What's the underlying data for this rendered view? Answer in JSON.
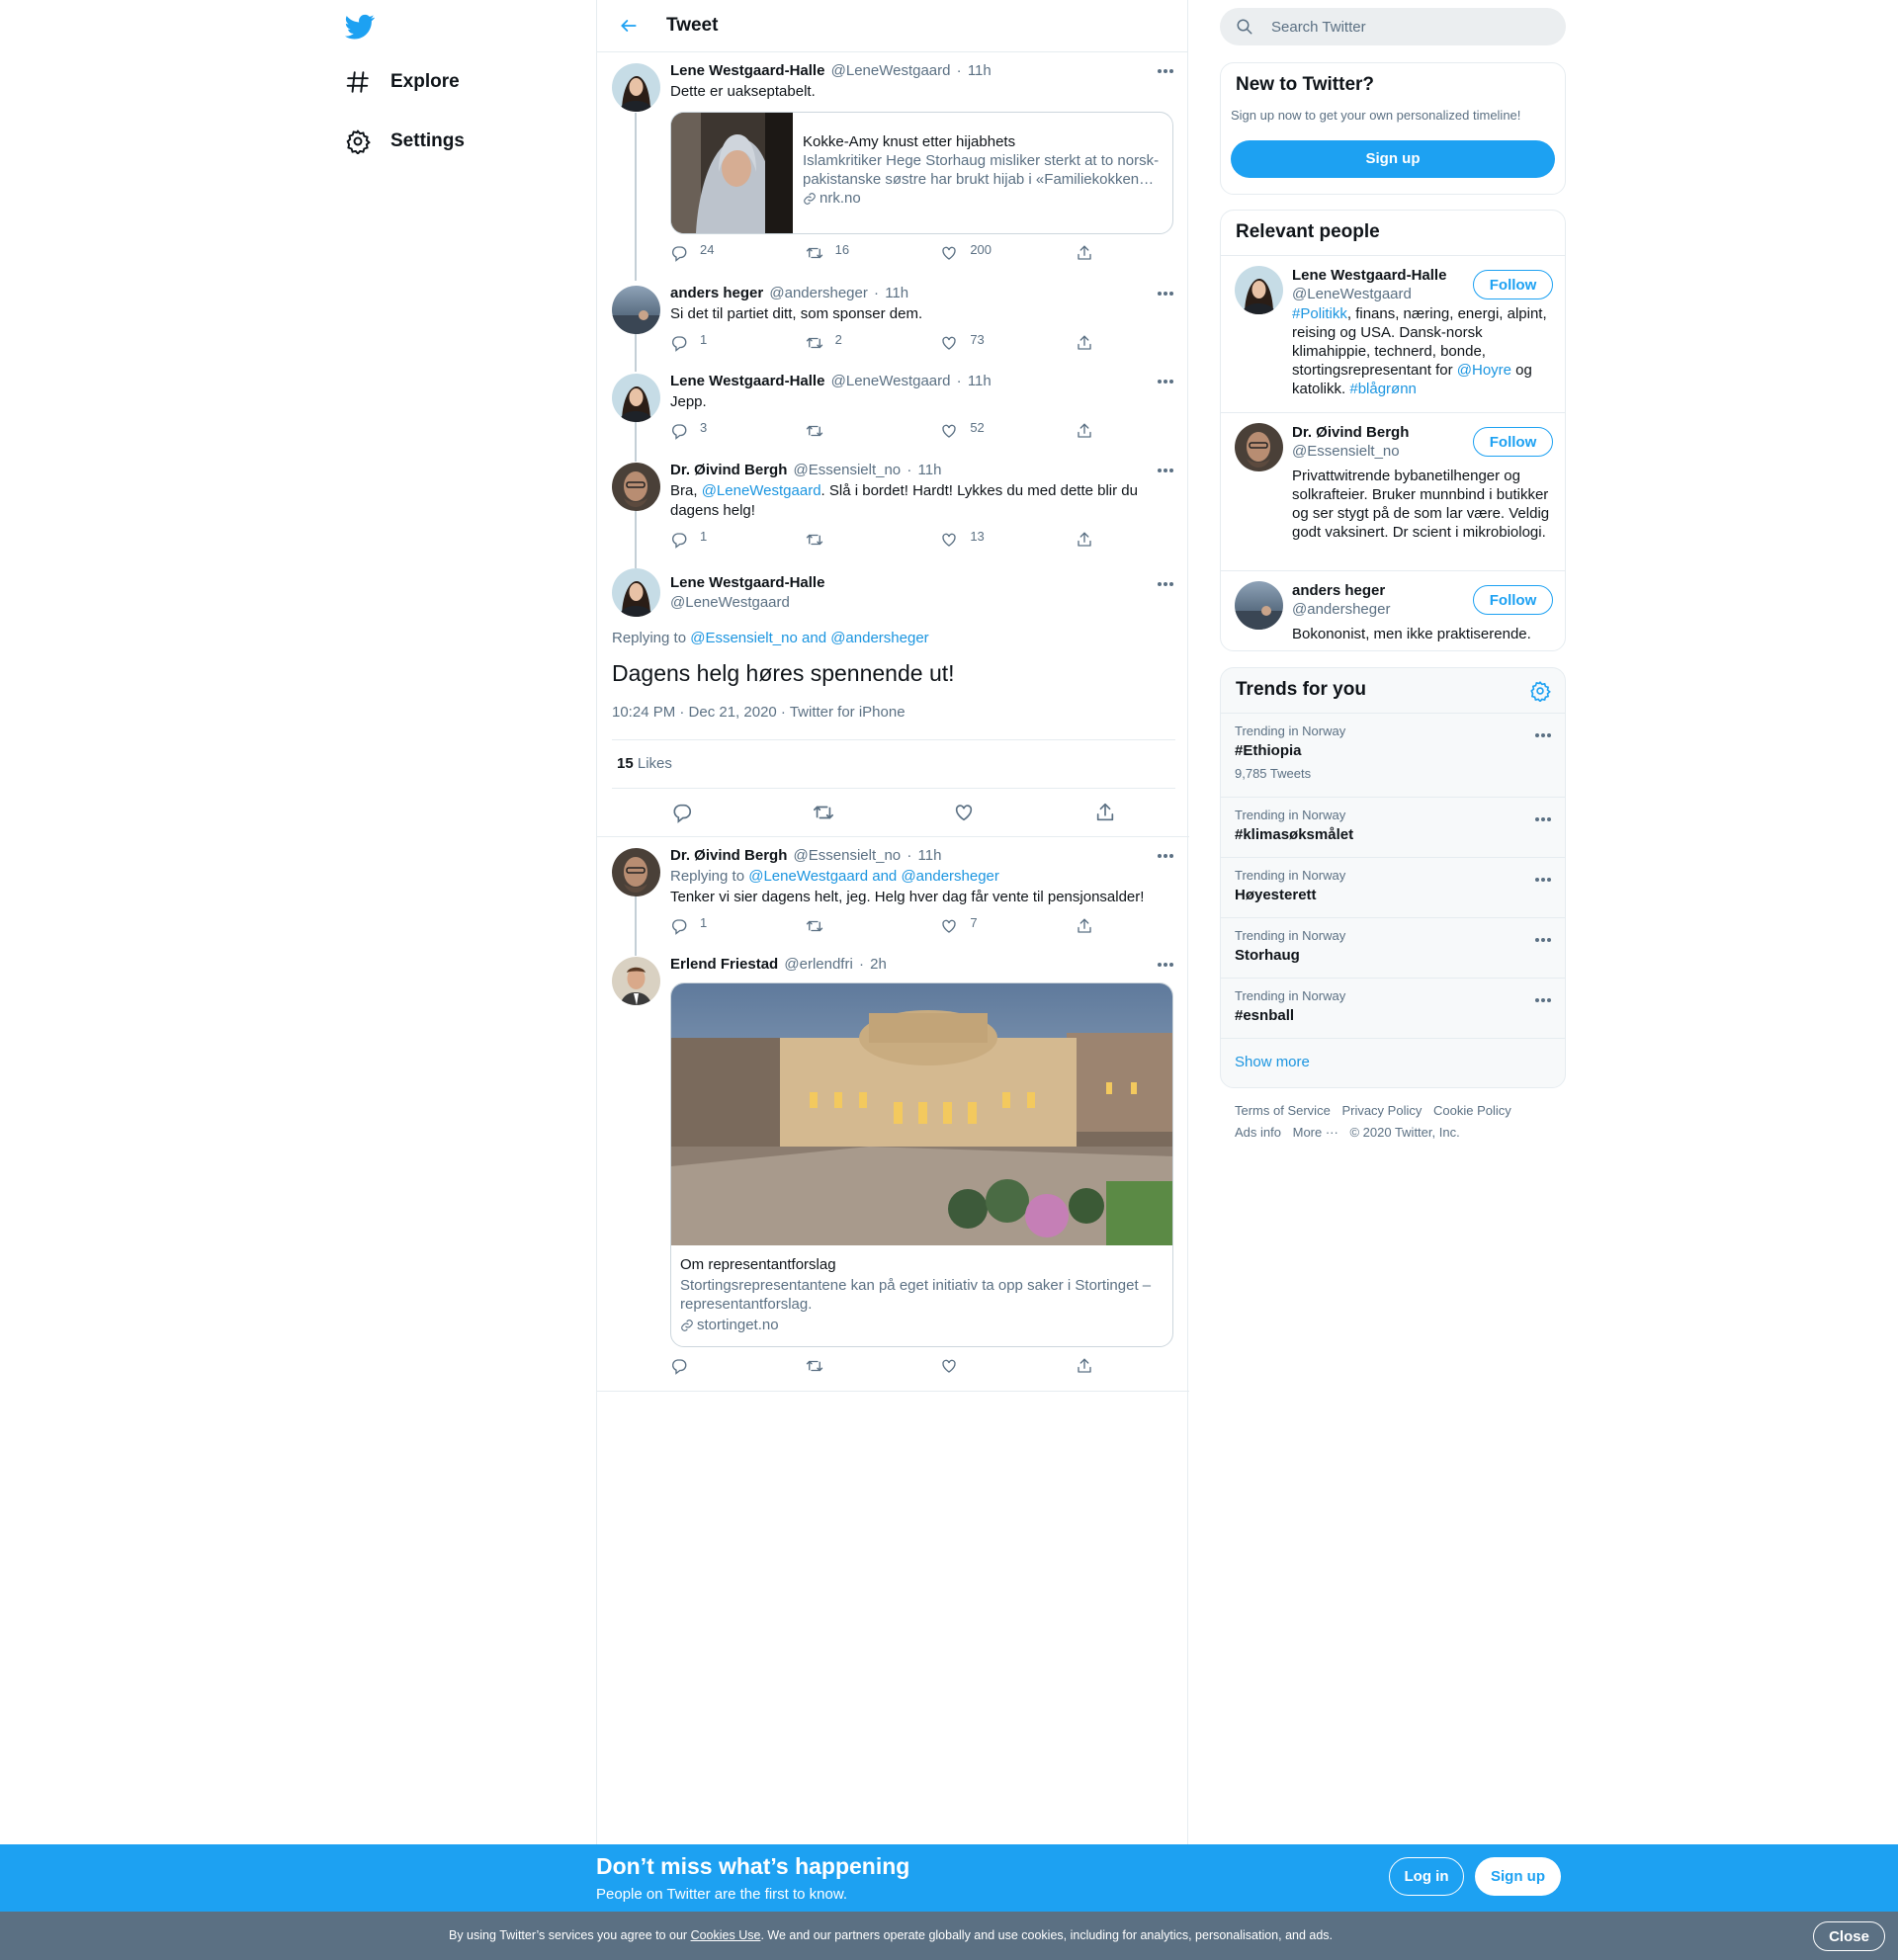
{
  "nav": {
    "explore": "Explore",
    "settings": "Settings"
  },
  "header": {
    "title": "Tweet"
  },
  "thread": [
    {
      "name": "Lene Westgaard-Halle",
      "handle": "@LeneWestgaard",
      "time": "11h",
      "text": "Dette er uakseptabelt.",
      "card": {
        "title": "Kokke-Amy knust etter hijabhets",
        "desc": "Islamkritiker Hege Storhaug misliker sterkt at to norsk-pakistanske søstre har brukt hijab i «Familiekokken…",
        "domain": "nrk.no"
      },
      "replies": "24",
      "retweets": "16",
      "likes": "200"
    },
    {
      "name": "anders heger",
      "handle": "@andersheger",
      "time": "11h",
      "text": "Si det til partiet ditt, som sponser dem.",
      "replies": "1",
      "retweets": "2",
      "likes": "73"
    },
    {
      "name": "Lene Westgaard-Halle",
      "handle": "@LeneWestgaard",
      "time": "11h",
      "text": "Jepp.",
      "replies": "3",
      "retweets": "",
      "likes": "52"
    },
    {
      "name": "Dr. Øivind Bergh",
      "handle": "@Essensielt_no",
      "time": "11h",
      "text_a": "Bra, ",
      "mention": "@LeneWestgaard",
      "text_b": ". Slå i bordet! Hardt! Lykkes du med dette blir du dagens helg!",
      "replies": "1",
      "retweets": "",
      "likes": "13"
    }
  ],
  "focus": {
    "name": "Lene Westgaard-Halle",
    "handle": "@LeneWestgaard",
    "replying_label": "Replying to",
    "replying_to": "@Essensielt_no and @andersheger",
    "text": "Dagens helg høres spennende ut!",
    "timestamp": "10:24 PM · Dec 21, 2020 · Twitter for iPhone",
    "likes_count": "15",
    "likes_label": "Likes"
  },
  "replies": [
    {
      "name": "Dr. Øivind Bergh",
      "handle": "@Essensielt_no",
      "time": "11h",
      "replying_label": "Replying to",
      "replying_to": "@LeneWestgaard and @andersheger",
      "text": "Tenker vi sier dagens helt, jeg. Helg hver dag får vente til pensjonsalder!",
      "replies": "1",
      "retweets": "",
      "likes": "7"
    },
    {
      "name": "Erlend Friestad",
      "handle": "@erlendfri",
      "time": "2h",
      "card": {
        "title": "Om representantforslag",
        "desc": "Stortingsrepresentantene kan på eget initiativ ta opp saker i Stortinget – representantforslag.",
        "domain": "stortinget.no"
      }
    }
  ],
  "sidebar": {
    "search_placeholder": "Search Twitter",
    "new_title": "New to Twitter?",
    "new_sub": "Sign up now to get your own personalized timeline!",
    "signup": "Sign up",
    "people_title": "Relevant people",
    "follow": "Follow",
    "people": [
      {
        "name": "Lene Westgaard-Halle",
        "handle": "@LeneWestgaard",
        "bio_a": "#Politikk",
        "bio_b": ", finans, næring, energi, alpint, reising og USA. Dansk-norsk klimahippie, technerd, bonde, stortingsrepresentant for ",
        "bio_c": "@Hoyre",
        "bio_d": " og katolikk. ",
        "bio_e": "#blågrønn"
      },
      {
        "name": "Dr. Øivind Bergh",
        "handle": "@Essensielt_no",
        "bio": "Privattwitrende bybanetilhenger og solkrafteier. Bruker munnbind i butikker og ser stygt på de som lar være. Veldig godt vaksinert. Dr scient i mikrobiologi."
      },
      {
        "name": "anders heger",
        "handle": "@andersheger",
        "bio": "Bokononist, men ikke praktiserende."
      }
    ],
    "trends_title": "Trends for you",
    "trends": [
      {
        "cat": "Trending in Norway",
        "name": "#Ethiopia",
        "count": "9,785 Tweets"
      },
      {
        "cat": "Trending in Norway",
        "name": "#klimasøksmålet"
      },
      {
        "cat": "Trending in Norway",
        "name": "Høyesterett"
      },
      {
        "cat": "Trending in Norway",
        "name": "Storhaug"
      },
      {
        "cat": "Trending in Norway",
        "name": "#esnball"
      }
    ],
    "show_more": "Show more",
    "footer": {
      "terms": "Terms of Service",
      "privacy": "Privacy Policy",
      "cookie": "Cookie Policy",
      "ads": "Ads info",
      "more": "More ···",
      "copyright": "© 2020 Twitter, Inc."
    }
  },
  "bottom": {
    "title": "Don’t miss what’s happening",
    "sub": "People on Twitter are the first to know.",
    "login": "Log in",
    "signup": "Sign up"
  },
  "cookies": {
    "text_a": "By using Twitter’s services you agree to our ",
    "link": "Cookies Use",
    "text_b": ". We and our partners operate globally and use cookies, including for analytics, personalisation, and ads.",
    "close": "Close"
  },
  "colors": {
    "accent": "#1da1f2",
    "link": "#1b95e0",
    "secondary_text": "#5b7083",
    "cookie_bar": "#5b7083"
  }
}
